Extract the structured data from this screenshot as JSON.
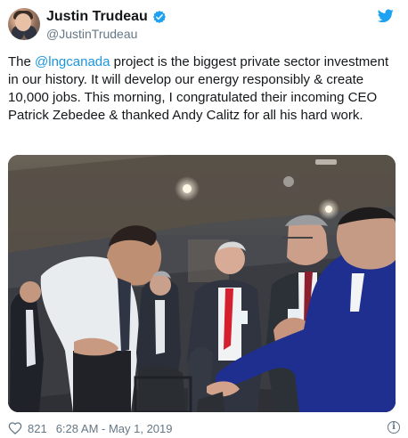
{
  "author": {
    "display_name": "Justin Trudeau",
    "handle": "@JustinTrudeau",
    "verified_icon": "verified-badge-icon",
    "avatar_icon": "avatar"
  },
  "brand": {
    "icon": "twitter-bird-icon",
    "accent_color": "#1da1f2"
  },
  "tweet": {
    "text_parts": [
      {
        "type": "text",
        "value": "The "
      },
      {
        "type": "mention",
        "value": "@lngcanada"
      },
      {
        "type": "text",
        "value": " project is the biggest private sector investment in our history. It will develop our energy responsibly & create 10,000 jobs. This morning, I congratulated their incoming CEO Patrick Zebedee & thanked Andy Calitz for all his hard work."
      }
    ]
  },
  "media": {
    "type": "photo"
  },
  "stats": {
    "likes": "821",
    "timestamp": "6:28 AM - May 1, 2019"
  },
  "footer": {
    "info_icon_glyph": "i"
  }
}
